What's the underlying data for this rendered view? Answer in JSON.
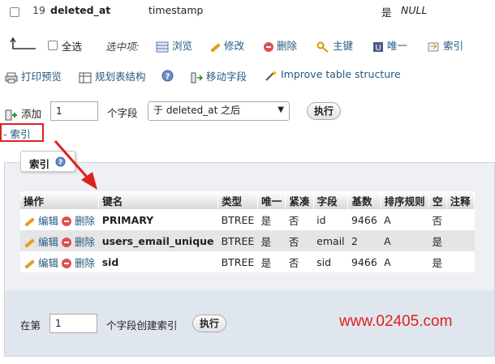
{
  "row19": {
    "num": "19",
    "name": "deleted_at",
    "type": "timestamp",
    "null": "是",
    "default": "NULL"
  },
  "bulk": {
    "select_all": "全选",
    "with_selected": "选中项:",
    "actions": [
      {
        "label": "浏览",
        "icon": "browse-icon"
      },
      {
        "label": "修改",
        "icon": "pencil-icon"
      },
      {
        "label": "删除",
        "icon": "delete-icon"
      },
      {
        "label": "主键",
        "icon": "key-icon"
      },
      {
        "label": "唯一",
        "icon": "unique-icon"
      },
      {
        "label": "索引",
        "icon": "index-icon"
      }
    ]
  },
  "tools": {
    "print": "打印预览",
    "plan": "规划表结构",
    "move": "移动字段",
    "improve": "Improve table structure"
  },
  "add": {
    "label": "添加",
    "count": "1",
    "fields_label": "个字段",
    "position": "于 deleted_at 之后",
    "go": "执行"
  },
  "index_toggle": "- 索引",
  "index_panel": {
    "legend": "索引",
    "headers": [
      "操作",
      "键名",
      "类型",
      "唯一",
      "紧凑",
      "字段",
      "基数",
      "排序规则",
      "空",
      "注释"
    ],
    "edit_label": "编辑",
    "drop_label": "删除",
    "rows": [
      {
        "key": "PRIMARY",
        "type": "BTREE",
        "unique": "是",
        "packed": "否",
        "column": "id",
        "cardinality": "9466",
        "collation": "A",
        "null": "否",
        "comment": ""
      },
      {
        "key": "users_email_unique",
        "type": "BTREE",
        "unique": "是",
        "packed": "否",
        "column": "email",
        "cardinality": "2",
        "collation": "A",
        "null": "是",
        "comment": ""
      },
      {
        "key": "sid",
        "type": "BTREE",
        "unique": "是",
        "packed": "否",
        "column": "sid",
        "cardinality": "9466",
        "collation": "A",
        "null": "是",
        "comment": ""
      }
    ],
    "create_prefix": "在第",
    "create_count": "1",
    "create_suffix": "个字段创建索引",
    "create_go": "执行"
  },
  "watermark": "www.02405.com",
  "colors": {
    "annotation_red": "#e02020",
    "watermark": "#e02020",
    "panel_bg": "#eef0f4",
    "footer_bg": "#dfe6ee"
  }
}
